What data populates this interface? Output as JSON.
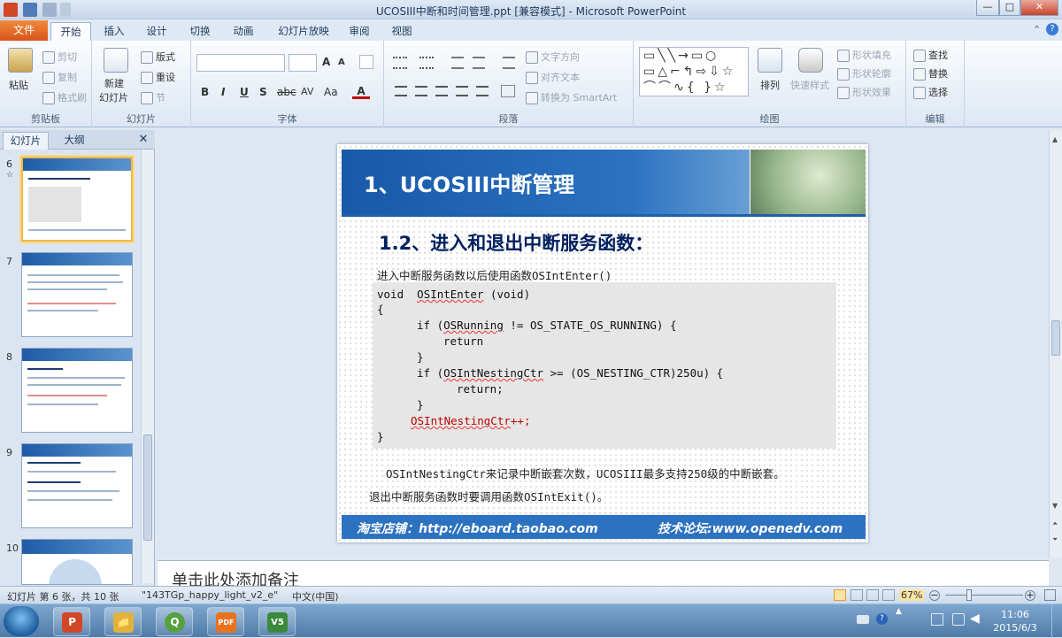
{
  "window": {
    "title": "UCOSIII中断和时间管理.ppt [兼容模式] - Microsoft PowerPoint",
    "controls": [
      "—",
      "□",
      "✕"
    ],
    "help": "?",
    "restore": "▭"
  },
  "ribbon_tabs": [
    "文件",
    "开始",
    "插入",
    "设计",
    "切换",
    "动画",
    "幻灯片放映",
    "审阅",
    "视图"
  ],
  "clipboard": {
    "label": "剪贴板",
    "paste": "粘贴",
    "cut": "剪切",
    "copy": "复制",
    "format_painter": "格式刷"
  },
  "slides_group": {
    "label": "幻灯片",
    "new_slide": "新建",
    "new_slide2": "幻灯片",
    "layout": "版式",
    "reset": "重设",
    "section": "节"
  },
  "font_group": {
    "label": "字体",
    "bold": "B",
    "italic": "I",
    "underline": "U",
    "shadow": "S",
    "strike": "abc",
    "spacing": "AV",
    "case": "Aa",
    "grow": "A",
    "shrink": "A"
  },
  "paragraph_group": {
    "label": "段落",
    "text_direction": "文字方向",
    "align_text": "对齐文本",
    "smartart": "转换为 SmartArt"
  },
  "drawing_group": {
    "label": "绘图",
    "arrange": "排列",
    "quick_styles": "快速样式",
    "shape_fill": "形状填充",
    "shape_outline": "形状轮廓",
    "shape_effects": "形状效果"
  },
  "editing_group": {
    "label": "编辑",
    "find": "查找",
    "replace": "替换",
    "select": "选择"
  },
  "pane_tabs": {
    "slides": "幻灯片",
    "outline": "大纲",
    "close": "✕"
  },
  "thumbnails": [
    {
      "num": "6",
      "title": "1、UCOSIII中断管理",
      "selected": true
    },
    {
      "num": "7",
      "title": "2、UCOSIII临界段代码保护",
      "selected": false
    },
    {
      "num": "8",
      "title": "3、UCOSIII时间管理",
      "selected": false
    },
    {
      "num": "9",
      "title": "3、UCOSIII时间管理",
      "selected": false
    },
    {
      "num": "10",
      "title": "",
      "selected": false
    }
  ],
  "slide": {
    "title": "1、UCOSIII中断管理",
    "subtitle": "1.2、进入和退出中断服务函数：",
    "intro": "进入中断服务函数以后使用函数OSIntEnter()",
    "code": {
      "l1a": "void  ",
      "l1b": "OSIntEnter",
      "l1c": " (void)",
      "l2": "{",
      "l3a": "if (",
      "l3b": "OSRunning",
      "l3c": " != OS_STATE_OS_RUNNING) {",
      "l4": "return",
      "l5": "}",
      "l6a": "if (",
      "l6b": "OSIntNestingCtr",
      "l6c": " >= (OS_NESTING_CTR)250u) {",
      "l7": "return;",
      "l8": "}",
      "l9a": "OSIntNestingCtr",
      "l9b": "++;",
      "l10": "}"
    },
    "note1": "OSIntNestingCtr来记录中断嵌套次数，UCOSIII最多支持250级的中断嵌套。",
    "note2": "退出中断服务函数时要调用函数OSIntExit()。",
    "footer_shop": "淘宝店铺：http://eboard.taobao.com",
    "footer_forum": "技术论坛:www.openedv.com"
  },
  "notes_placeholder": "单击此处添加备注",
  "status": {
    "slide_info": "幻灯片 第 6 张，共 10 张",
    "theme": "\"143TGp_happy_light_v2_e\"",
    "language": "中文(中国)",
    "zoom": "67%"
  },
  "taskbar": {
    "apps": [
      {
        "name": "PowerPoint",
        "label": "P",
        "color": "#d24726"
      },
      {
        "name": "Explorer",
        "label": "📁",
        "color": "#e2b33c"
      },
      {
        "name": "App3",
        "label": "Q",
        "color": "#56a03f"
      },
      {
        "name": "PDF",
        "label": "PDF",
        "color": "#e8731f"
      },
      {
        "name": "Keil",
        "label": "V5",
        "color": "#3b8a3b"
      }
    ],
    "time": "11:06",
    "date": "2015/6/3"
  }
}
